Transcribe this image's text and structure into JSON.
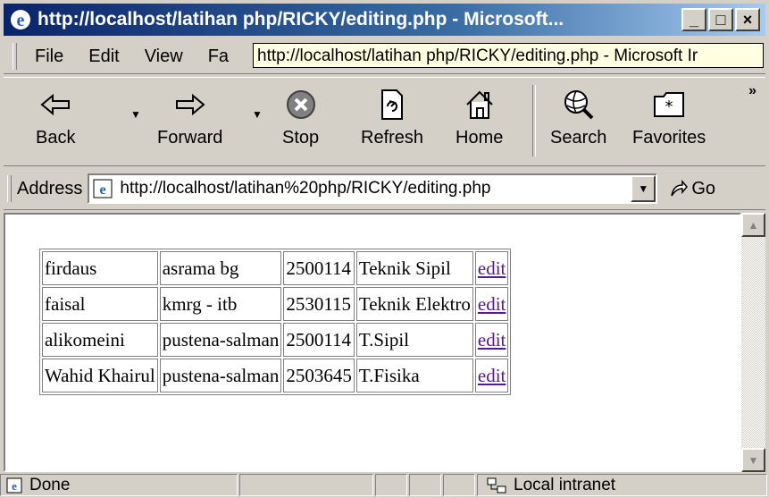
{
  "window": {
    "title": "http://localhost/latihan php/RICKY/editing.php - Microsoft...",
    "minimize": "_",
    "maximize": "□",
    "close": "×"
  },
  "menu": {
    "items": [
      "File",
      "Edit",
      "View",
      "Fa"
    ]
  },
  "tooltip": "http://localhost/latihan php/RICKY/editing.php - Microsoft Ir",
  "toolbar": {
    "back": "Back",
    "forward": "Forward",
    "stop": "Stop",
    "refresh": "Refresh",
    "home": "Home",
    "search": "Search",
    "favorites": "Favorites",
    "more": "»"
  },
  "address": {
    "label": "Address",
    "url": "http://localhost/latihan%20php/RICKY/editing.php",
    "go": "Go"
  },
  "table": {
    "rows": [
      [
        "firdaus",
        "asrama bg",
        "2500114",
        "Teknik Sipil",
        "edit"
      ],
      [
        "faisal",
        "kmrg - itb",
        "2530115",
        "Teknik Elektro",
        "edit"
      ],
      [
        "alikomeini",
        "pustena-salman",
        "2500114",
        "T.Sipil",
        "edit"
      ],
      [
        "Wahid Khairul",
        "pustena-salman",
        "2503645",
        "T.Fisika",
        "edit"
      ]
    ]
  },
  "status": {
    "text": "Done",
    "zone": "Local intranet"
  },
  "colors": {
    "title_bar": "#0a246a",
    "link_visited": "#551a8b",
    "chrome": "#d4d0c8"
  }
}
